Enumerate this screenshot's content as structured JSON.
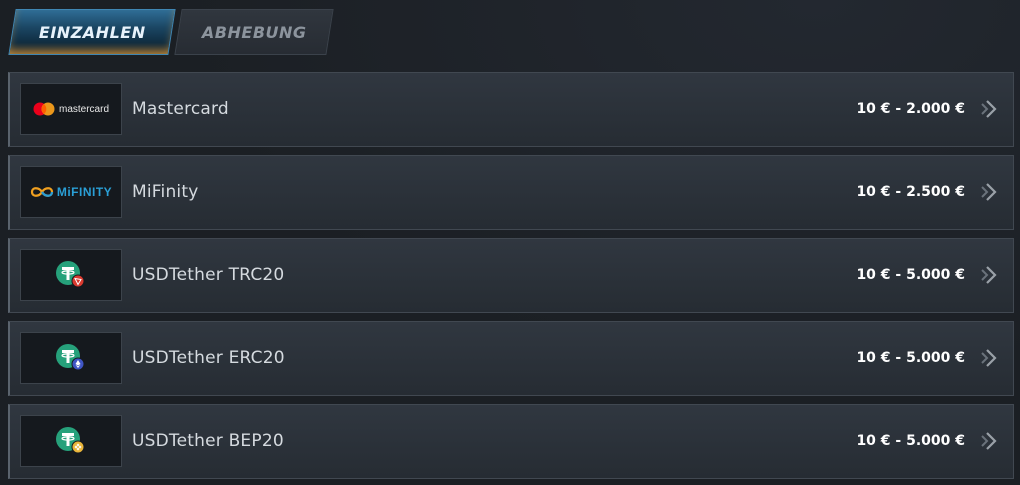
{
  "tabs": {
    "deposit_label": "EINZAHLEN",
    "withdraw_label": "ABHEBUNG"
  },
  "methods": [
    {
      "name": "Mastercard",
      "range": "10 € - 2.000 €",
      "logo_text": "mastercard",
      "icon": "mastercard-icon"
    },
    {
      "name": "MiFinity",
      "range": "10 € - 2.500 €",
      "logo_text": "MiFINITY",
      "icon": "mifinity-icon"
    },
    {
      "name": "USDTether TRC20",
      "range": "10 € - 5.000 €",
      "icon": "tether-tron-icon"
    },
    {
      "name": "USDTether ERC20",
      "range": "10 € - 5.000 €",
      "icon": "tether-ethereum-icon"
    },
    {
      "name": "USDTether BEP20",
      "range": "10 € - 5.000 €",
      "icon": "tether-bnb-icon"
    }
  ],
  "colors": {
    "background": "#1b1f24",
    "row": "#2b3139",
    "tether": "#26a17b",
    "tron": "#d93a2f",
    "ethereum": "#3f55c4",
    "bnb": "#e9b53a",
    "mastercard_red": "#eb001b",
    "mastercard_orange": "#f79e1b",
    "mifinity_blue": "#2a9fd6"
  }
}
